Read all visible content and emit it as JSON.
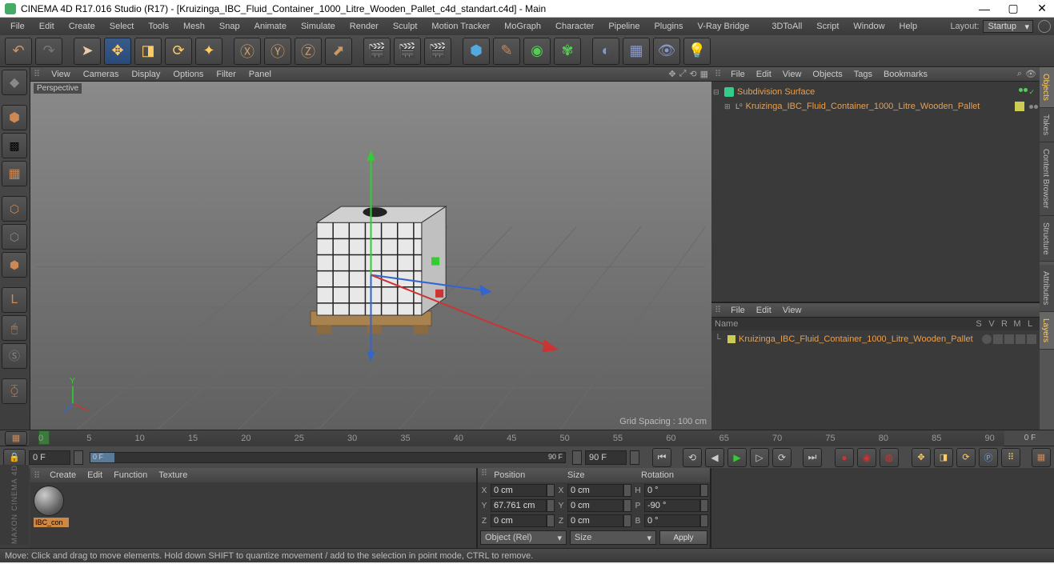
{
  "window": {
    "title": "CINEMA 4D R17.016 Studio (R17) - [Kruizinga_IBC_Fluid_Container_1000_Litre_Wooden_Pallet_c4d_standart.c4d] - Main"
  },
  "menu": {
    "items": [
      "File",
      "Edit",
      "Create",
      "Select",
      "Tools",
      "Mesh",
      "Snap",
      "Animate",
      "Simulate",
      "Render",
      "Sculpt",
      "Motion Tracker",
      "MoGraph",
      "Character",
      "Pipeline",
      "Plugins",
      "V-Ray Bridge",
      "3DToAll",
      "Script",
      "Window",
      "Help"
    ],
    "layout_label": "Layout:",
    "layout_value": "Startup"
  },
  "viewport": {
    "menus": [
      "View",
      "Cameras",
      "Display",
      "Options",
      "Filter",
      "Panel"
    ],
    "label": "Perspective",
    "grid_spacing": "Grid Spacing : 100 cm"
  },
  "objects_panel": {
    "menus": [
      "File",
      "Edit",
      "View",
      "Objects",
      "Tags",
      "Bookmarks"
    ],
    "tree": [
      {
        "name": "Subdivision Surface",
        "indent": 0
      },
      {
        "name": "Kruizinga_IBC_Fluid_Container_1000_Litre_Wooden_Pallet",
        "indent": 1
      }
    ]
  },
  "layers_panel": {
    "menus": [
      "File",
      "Edit",
      "View"
    ],
    "head_name": "Name",
    "head_cols": [
      "S",
      "V",
      "R",
      "M",
      "L"
    ],
    "rows": [
      "Kruizinga_IBC_Fluid_Container_1000_Litre_Wooden_Pallet"
    ]
  },
  "right_tabs": [
    "Objects",
    "Takes",
    "Content Browser",
    "Structure",
    "Attributes",
    "Layers"
  ],
  "timeline": {
    "ticks": [
      "0",
      "5",
      "10",
      "15",
      "20",
      "25",
      "30",
      "35",
      "40",
      "45",
      "50",
      "55",
      "60",
      "65",
      "70",
      "75",
      "80",
      "85",
      "90"
    ],
    "end_label": "0 F",
    "start_frame": "0 F",
    "range_start": "0 F",
    "range_end": "90 F",
    "current_frame": "90 F"
  },
  "materials": {
    "menus": [
      "Create",
      "Edit",
      "Function",
      "Texture"
    ],
    "items": [
      "IBC_con"
    ]
  },
  "coords": {
    "headers": [
      "Position",
      "Size",
      "Rotation"
    ],
    "rows": [
      {
        "axis": "X",
        "pos": "0 cm",
        "saxis": "X",
        "size": "0 cm",
        "raxis": "H",
        "rot": "0 °"
      },
      {
        "axis": "Y",
        "pos": "67.761 cm",
        "saxis": "Y",
        "size": "0 cm",
        "raxis": "P",
        "rot": "-90 °"
      },
      {
        "axis": "Z",
        "pos": "0 cm",
        "saxis": "Z",
        "size": "0 cm",
        "raxis": "B",
        "rot": "0 °"
      }
    ],
    "mode_obj": "Object (Rel)",
    "mode_size": "Size",
    "apply": "Apply"
  },
  "status": {
    "hint": "Move: Click and drag to move elements. Hold down SHIFT to quantize movement / add to the selection in point mode, CTRL to remove."
  },
  "maxon": "MAXON  CINEMA 4D"
}
